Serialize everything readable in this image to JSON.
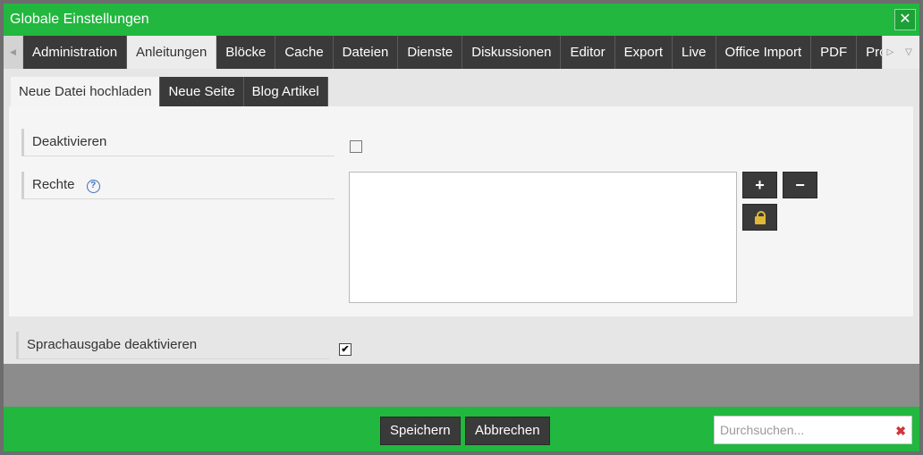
{
  "window": {
    "title": "Globale Einstellungen",
    "close_glyph": "✕"
  },
  "main_tabs": [
    {
      "label": "Administration",
      "active": false
    },
    {
      "label": "Anleitungen",
      "active": true
    },
    {
      "label": "Blöcke",
      "active": false
    },
    {
      "label": "Cache",
      "active": false
    },
    {
      "label": "Dateien",
      "active": false
    },
    {
      "label": "Dienste",
      "active": false
    },
    {
      "label": "Diskussionen",
      "active": false
    },
    {
      "label": "Editor",
      "active": false
    },
    {
      "label": "Export",
      "active": false
    },
    {
      "label": "Live",
      "active": false
    },
    {
      "label": "Office Import",
      "active": false
    },
    {
      "label": "PDF",
      "active": false
    },
    {
      "label": "Proxy",
      "active": false
    }
  ],
  "sub_tabs": [
    {
      "label": "Neue Datei hochladen",
      "active": true
    },
    {
      "label": "Neue Seite",
      "active": false
    },
    {
      "label": "Blog Artikel",
      "active": false
    }
  ],
  "form": {
    "deactivate_label": "Deaktivieren",
    "deactivate_checked": false,
    "rights_label": "Rechte",
    "rights_help": "?",
    "rights_items": [],
    "add_glyph": "+",
    "remove_glyph": "−",
    "speech_label": "Sprachausgabe deaktivieren",
    "speech_checked": true
  },
  "footer": {
    "save_label": "Speichern",
    "cancel_label": "Abbrechen",
    "search_placeholder": "Durchsuchen...",
    "search_value": "",
    "clear_glyph": "✖"
  },
  "colors": {
    "accent": "#22b73f",
    "tab_dark": "#3a3a3a",
    "help_blue": "#3b6fc2",
    "clear_red": "#d0353a"
  }
}
